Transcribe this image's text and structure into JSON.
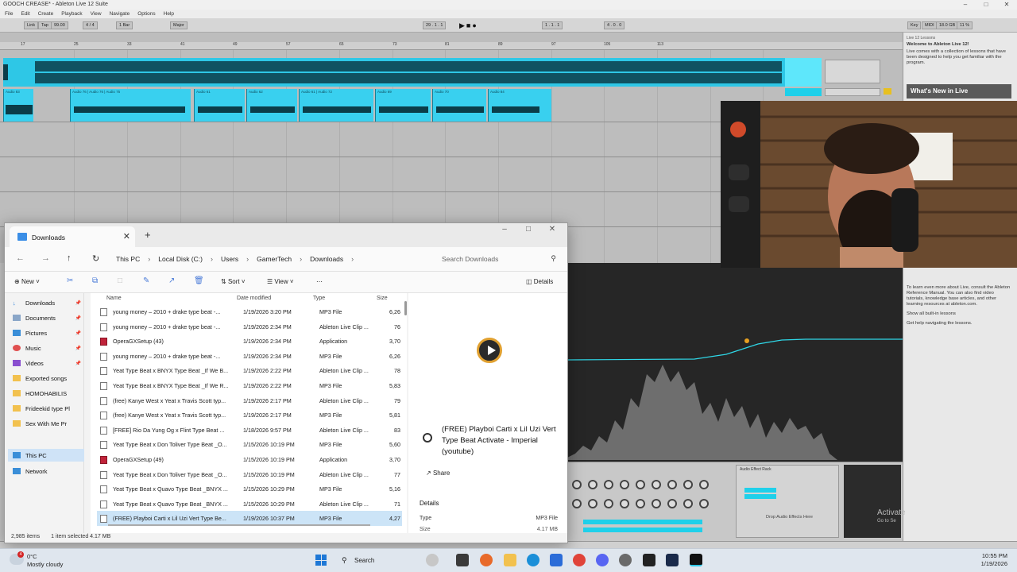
{
  "ableton": {
    "window_title": "GOOCH CREASE* - Ableton Live 12 Suite",
    "menu": [
      "File",
      "Edit",
      "Create",
      "Playback",
      "View",
      "Navigate",
      "Options",
      "Help"
    ],
    "transport": {
      "link": "Link",
      "tap": "Tap",
      "tempo": "99.00",
      "time_sig": "4 / 4",
      "bar": "1 Bar",
      "key": "Major",
      "position": "29 . 1 . 1",
      "loop_start": "1 . 1 . 1",
      "loop_len": "4 . 0 . 0",
      "cpu": "11 %",
      "key_label": "Key",
      "midi_label": "MIDI",
      "mem": "18.0 GB"
    },
    "ruler_marks": [
      "17",
      "25",
      "33",
      "41",
      "49",
      "57",
      "65",
      "73",
      "81",
      "89",
      "97",
      "105",
      "113"
    ],
    "lessons": {
      "header": "Live 12 Lessons",
      "welcome": "Welcome to Ableton Live 12!",
      "intro": "Live comes with a collection of lessons that have been designed to help you get familiar with the program.",
      "whats_new": "What's New in Live",
      "body1": "To learn even more about Live, consult the Ableton Reference Manual. You can also find video tutorials, knowledge base articles, and other learning resources at ableton.com.",
      "body2": "Show all built-in lessons",
      "body3": "Get help navigating the lessons."
    },
    "devices": {
      "drop_label": "Drop Audio Effects Here",
      "rack_title": "Audio Effect Rack"
    },
    "activate_title": "Activate",
    "activate_sub": "Go to Se"
  },
  "explorer": {
    "tab_title": "Downloads",
    "breadcrumb": [
      "This PC",
      "Local Disk (C:)",
      "Users",
      "GamerTech",
      "Downloads"
    ],
    "search_placeholder": "Search Downloads",
    "toolbar": {
      "new": "New",
      "sort": "Sort",
      "view": "View",
      "more": "⋯",
      "details": "Details"
    },
    "nav": [
      {
        "label": "Downloads",
        "pinned": true
      },
      {
        "label": "Documents",
        "pinned": true
      },
      {
        "label": "Pictures",
        "pinned": true
      },
      {
        "label": "Music",
        "pinned": true
      },
      {
        "label": "Videos",
        "pinned": true
      },
      {
        "label": "Exported songs",
        "pinned": false
      },
      {
        "label": "HOMOHABILIS",
        "pinned": false
      },
      {
        "label": "Frideekid type Pl",
        "pinned": false
      },
      {
        "label": "Sex With Me Pr",
        "pinned": false
      },
      {
        "label": "This PC",
        "pinned": false
      },
      {
        "label": "Network",
        "pinned": false
      }
    ],
    "columns": {
      "name": "Name",
      "date": "Date modified",
      "type": "Type",
      "size": "Size"
    },
    "files": [
      {
        "name": "young money – 2010 + drake type beat -...",
        "date": "1/19/2026 3:20 PM",
        "type": "MP3 File",
        "size": "6,26",
        "kind": "file"
      },
      {
        "name": "young money – 2010 + drake type beat -...",
        "date": "1/19/2026 2:34 PM",
        "type": "Ableton Live Clip ...",
        "size": "76",
        "kind": "file"
      },
      {
        "name": "OperaGXSetup (43)",
        "date": "1/19/2026 2:34 PM",
        "type": "Application",
        "size": "3,70",
        "kind": "app"
      },
      {
        "name": "young money – 2010 + drake type beat -...",
        "date": "1/19/2026 2:34 PM",
        "type": "MP3 File",
        "size": "6,26",
        "kind": "file"
      },
      {
        "name": "Yeat Type Beat x BNYX Type Beat _If We B...",
        "date": "1/19/2026 2:22 PM",
        "type": "Ableton Live Clip ...",
        "size": "78",
        "kind": "file"
      },
      {
        "name": "Yeat Type Beat x BNYX Type Beat _If We R...",
        "date": "1/19/2026 2:22 PM",
        "type": "MP3 File",
        "size": "5,83",
        "kind": "file"
      },
      {
        "name": "(free) Kanye West x Yeat x Travis Scott typ...",
        "date": "1/19/2026 2:17 PM",
        "type": "Ableton Live Clip ...",
        "size": "79",
        "kind": "file"
      },
      {
        "name": "(free) Kanye West x Yeat x Travis Scott typ...",
        "date": "1/19/2026 2:17 PM",
        "type": "MP3 File",
        "size": "5,81",
        "kind": "file"
      },
      {
        "name": "[FREE] Rio Da Yung Og x Flint Type Beat ...",
        "date": "1/18/2026 9:57 PM",
        "type": "Ableton Live Clip ...",
        "size": "83",
        "kind": "file"
      },
      {
        "name": "Yeat Type Beat x Don Toliver Type Beat _O...",
        "date": "1/15/2026 10:19 PM",
        "type": "MP3 File",
        "size": "5,60",
        "kind": "file"
      },
      {
        "name": "OperaGXSetup (49)",
        "date": "1/15/2026 10:19 PM",
        "type": "Application",
        "size": "3,70",
        "kind": "app"
      },
      {
        "name": "Yeat Type Beat x Don Toliver Type Beat _O...",
        "date": "1/15/2026 10:19 PM",
        "type": "Ableton Live Clip ...",
        "size": "77",
        "kind": "file"
      },
      {
        "name": "Yeat Type Beat x Quavo Type Beat _BNYX ...",
        "date": "1/15/2026 10:29 PM",
        "type": "MP3 File",
        "size": "5,16",
        "kind": "file"
      },
      {
        "name": "Yeat Type Beat x Quavo Type Beat _BNYX ...",
        "date": "1/15/2026 10:29 PM",
        "type": "Ableton Live Clip ...",
        "size": "71",
        "kind": "file"
      },
      {
        "name": "(FREE) Playboi Carti x Lil Uzi Vert Type Be...",
        "date": "1/19/2026 10:37 PM",
        "type": "MP3 File",
        "size": "4,27",
        "kind": "file"
      }
    ],
    "preview": {
      "title": "(FREE) Playboi Carti x Lil Uzi Vert Type Beat Activate - Imperial (youtube)",
      "share": "Share",
      "details_label": "Details",
      "type_label": "Type",
      "type_value": "MP3 File",
      "size_label": "Size",
      "size_value": "4.17 MB"
    },
    "status": {
      "items": "2,985 items",
      "selected": "1 item selected  4.17 MB"
    }
  },
  "taskbar": {
    "temp": "0°C",
    "weather": "Mostly cloudy",
    "search": "Search",
    "time": "10:55 PM",
    "date": "1/19/2026",
    "notif_count": "4"
  },
  "colors": {
    "clip": "#2ec7e6",
    "accent": "#1e78d6"
  }
}
